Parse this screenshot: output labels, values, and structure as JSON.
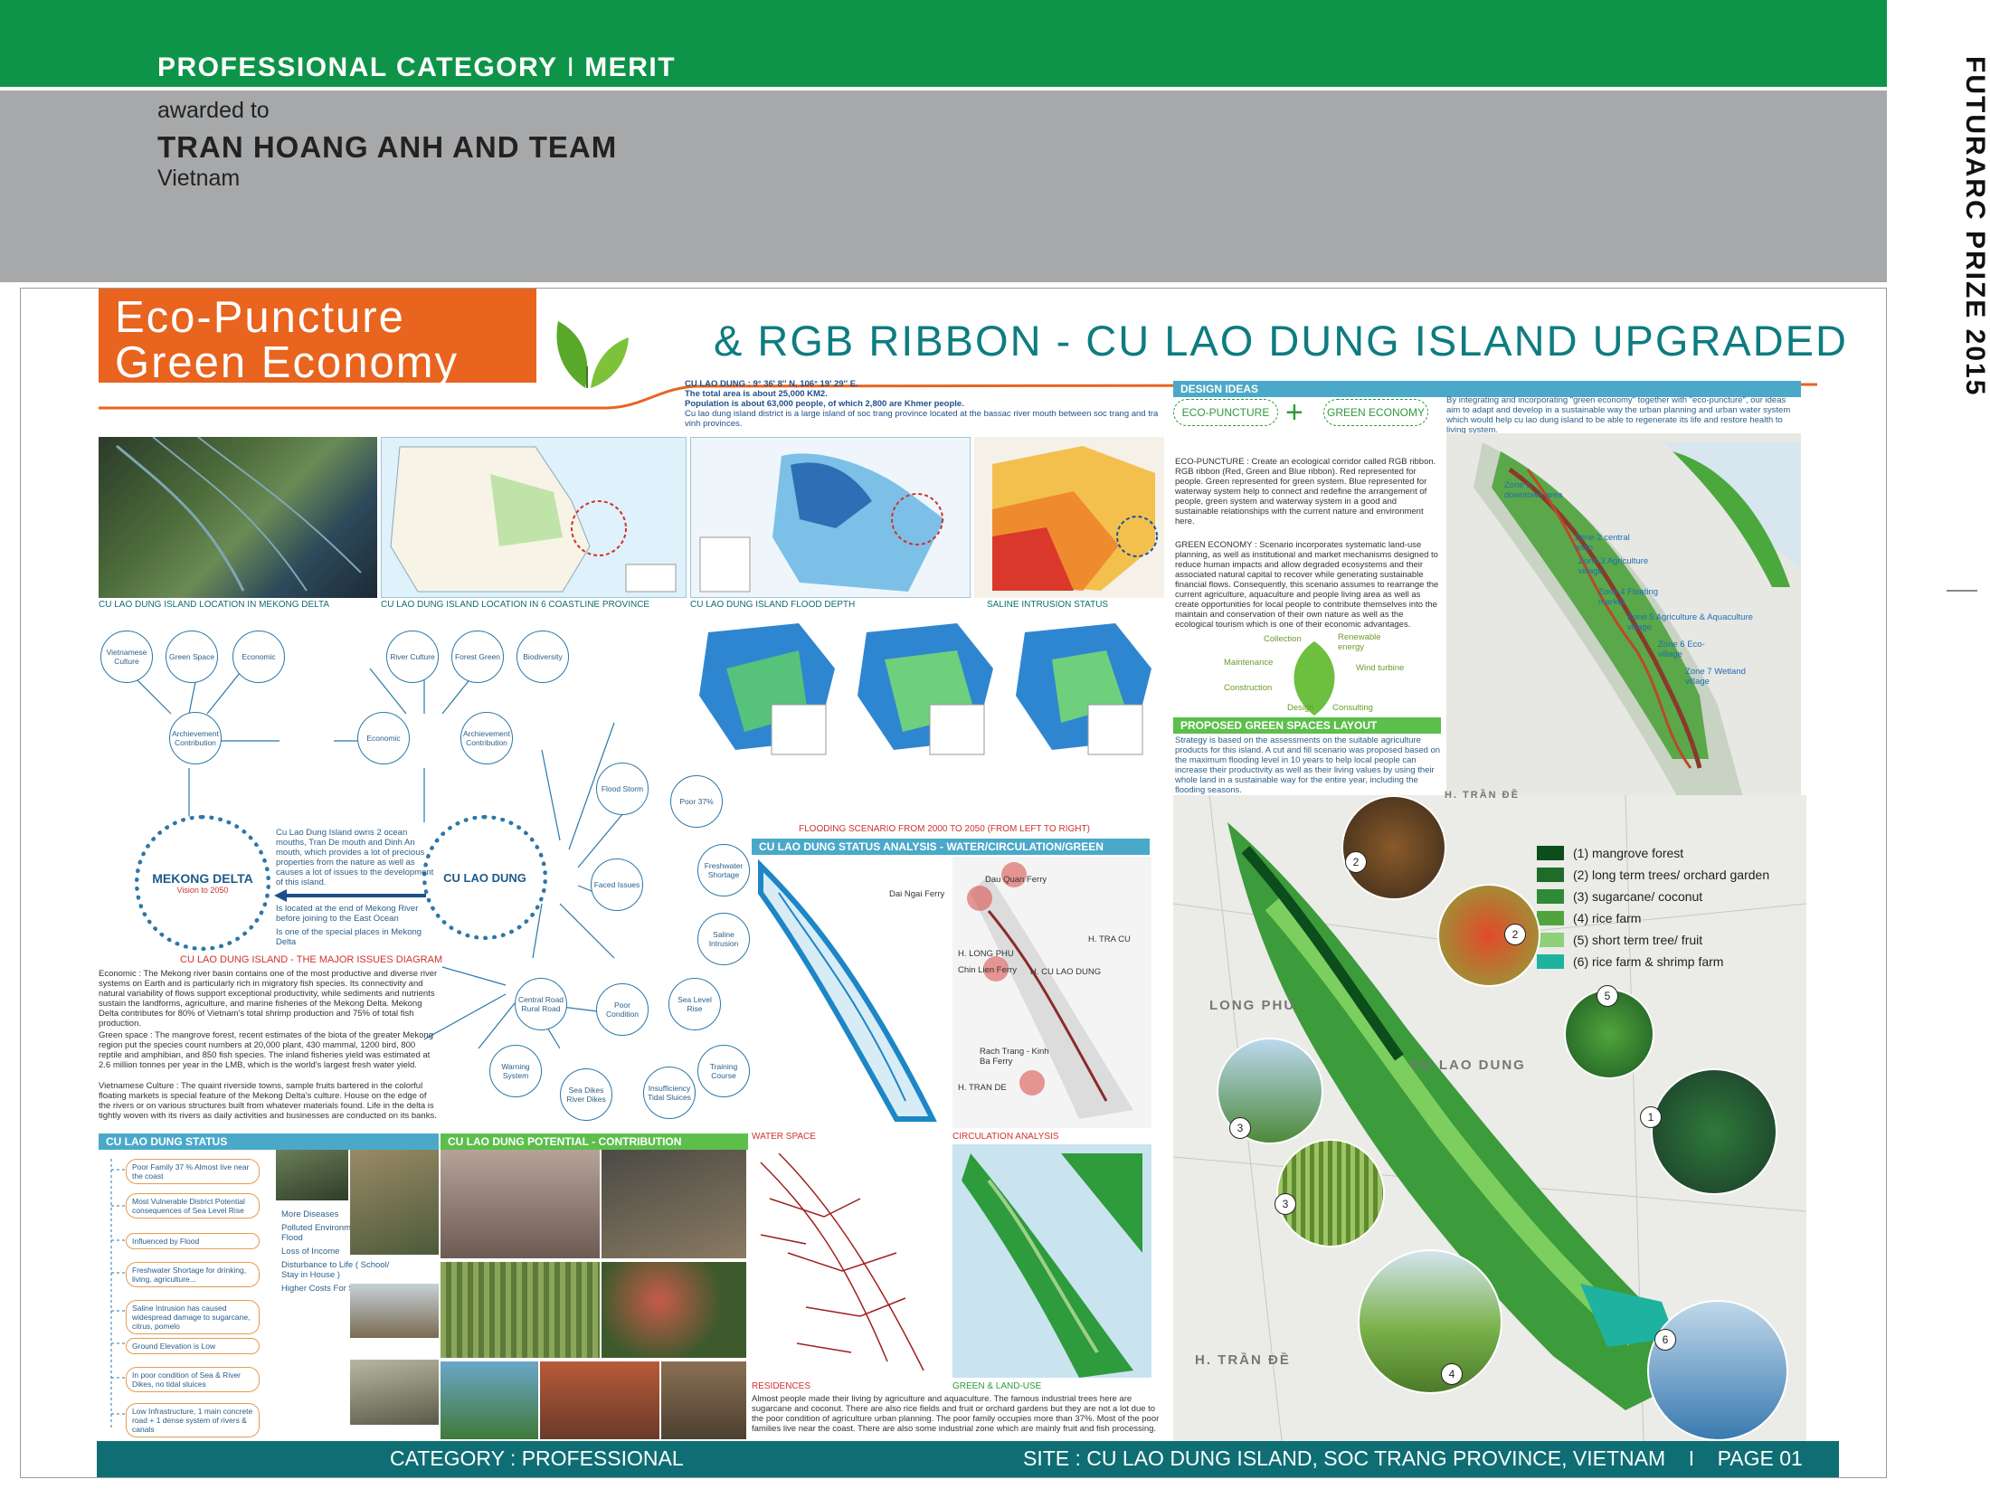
{
  "award": {
    "category": "PROFESSIONAL CATEGORY",
    "separator": "I",
    "level": "MERIT",
    "awarded_to": "awarded to",
    "team": "TRAN HOANG ANH AND TEAM",
    "country": "Vietnam",
    "prize": "FUTURARC PRIZE 2015"
  },
  "poster": {
    "logo_line1": "Eco-Puncture",
    "logo_line2": "Green Economy",
    "title": "& RGB RIBBON - CU LAO DUNG ISLAND UPGRADED",
    "intro": {
      "line1": "CU LAO DUNG : 9° 36' 8'' N, 106° 19' 29'' E.",
      "line2": "The total area is about 25,000 KM2.",
      "line3": "Population is about 63,000 people, of which 2,800 are Khmer people.",
      "line4": "Cu lao dung island district is a large island of soc trang province located at the bassac river mouth between soc trang and tra vinh provinces."
    },
    "captions": {
      "mekong_location": "CU LAO DUNG ISLAND LOCATION IN MEKONG DELTA",
      "coastline_location": "CU LAO DUNG ISLAND LOCATION IN 6 COASTLINE PROVINCE",
      "flood_depth": "CU LAO DUNG ISLAND FLOOD DEPTH",
      "saline": "SALINE INTRUSION STATUS",
      "flooding_scenario": "FLOODING SCENARIO FROM 2000 TO 2050 (FROM LEFT TO RIGHT)",
      "issues_diagram": "CU LAO DUNG ISLAND - THE MAJOR ISSUES DIAGRAM",
      "water_space": "WATER SPACE",
      "circulation": "CIRCULATION ANALYSIS",
      "residences": "RESIDENCES",
      "green_land": "GREEN & LAND-USE"
    },
    "bars": {
      "status_analysis": "CU LAO DUNG STATUS ANALYSIS - WATER/CIRCULATION/GREEN",
      "status": "CU LAO DUNG STATUS",
      "potential": "CU LAO DUNG POTENTIAL - CONTRIBUTION",
      "design_ideas": "DESIGN IDEAS",
      "green_spaces": "PROPOSED GREEN SPACES LAYOUT"
    },
    "diagram": {
      "top_nodes": [
        "Vietnamese Culture",
        "Green Space",
        "Economic",
        "River Culture",
        "Forest Green",
        "Biodiversity"
      ],
      "achievement_left": "Archievement Contribution",
      "economic_mid": "Economic",
      "achievement_right": "Archievement Contribution",
      "mekong": "MEKONG DELTA",
      "vision": "Vision to 2050",
      "culaodung": "CU LAO DUNG",
      "faced_issues": "Faced Issues",
      "poor_condition": "Poor Condition",
      "issue_nodes": [
        "Flood Storm",
        "Poor 37%",
        "Freshwater Shortage",
        "Saline Intrusion",
        "Sea Level Rise",
        "Training Course",
        "Insufficiency Tidal Sluices",
        "Sea Dikes River Dikes",
        "Warning System",
        "Central Road Rural Road"
      ],
      "note1": "Cu Lao Dung Island owns 2 ocean mouths, Tran De mouth and Dinh An mouth, which provides a lot of precious properties from the nature as well as causes a lot of issues to the development of this island.",
      "note2": "Is located at the end of Mekong River before joining to the East Ocean",
      "note3": "Is one of the special places in Mekong Delta"
    },
    "paragraphs": {
      "economic": "Economic : The Mekong river basin contains one of the most productive and diverse river systems on Earth and is particularly rich in migratory fish species. Its connectivity and natural variability of flows support exceptional productivity, while sediments and nutrients sustain the landforms, agriculture, and marine fisheries of the Mekong Delta. Mekong Delta contributes for 80% of Vietnam's total shrimp production and 75% of total fish production.",
      "green": "Green space : The mangrove forest, recent estimates of the biota of the greater Mekong region put the species count numbers at 20,000 plant, 430 mammal, 1200 bird, 800 reptile and amphibian, and 850 fish species. The inland fisheries yield was estimated at 2.6 million tonnes per year in the LMB, which is the world's largest fresh water yield.",
      "culture": "Vietnamese Culture : The quaint riverside towns, sample fruits bartered in the colorful floating markets is special feature of the Mekong Delta's culture. House on the edge of the rivers or on various structures built from whatever materials found. Life in the delta is tightly woven with its rivers as daily activities and businesses are conducted on its banks."
    },
    "status_items": [
      "Poor Family 37 % Almost live near the coast",
      "Most Vulnerable District Potential consequences of Sea Level Rise",
      "Influenced by Flood",
      "Freshwater Shortage for drinking, living, agriculture...",
      "Saline Intrusion has caused widespread damage to sugarcane, citrus, pomelo",
      "Ground Elevation is Low",
      "In poor condition of Sea & River Dikes, no tidal sluices",
      "Low Infrastructure, 1 main concrete road + 1 dense system of rivers & canals"
    ],
    "flood_effects": [
      "More Diseases",
      "Polluted Environment during Flood",
      "Loss of Income",
      "Disturbance to Life ( School/ Stay in House )",
      "Higher Costs For Sanitation"
    ],
    "map_labels": {
      "ferry1": "Dai Ngai Ferry",
      "ferry2": "Dau Quan Ferry",
      "ferry3": "Chin Lien Ferry",
      "ferry4": "Rach Trang - Kinh Ba Ferry",
      "cu_lao": "H. CU LAO DUNG",
      "tra_cu": "H. TRA CU",
      "long_phu_small": "H. LONG PHU",
      "tran_de_small": "H. TRAN DE"
    },
    "residence_text": "Almost people made their living by agriculture and aquaculture. The famous industrial trees here are sugarcane and coconut. There are also rice fields and fruit or orchard gardens but they are not a lot due to the poor condition of agriculture urban planning. The poor family occupies more than 37%. Most of the poor families live near the coast. There are also some industrial zone which are mainly fruit and fish processing.",
    "design": {
      "eco": "ECO-PUNCTURE",
      "green": "GREEN ECONOMY",
      "plus": "+",
      "intro": "By integrating and incorporating \"green economy\" together with \"eco-puncture\", our ideas aim to adapt and develop in a sustainable way the urban planning and urban water system which would help cu lao dung island to be able to regenerate its life and restore health to living system.",
      "eco_text": "ECO-PUNCTURE : Create an ecological corridor called RGB ribbon. RGB ribbon (Red, Green and Blue ribbon). Red represented for people. Green represented for green system. Blue represented for waterway system help to connect and redefine the arrangement of people, green system and waterway system in a good and sustainable relationships with the current nature and environment here.",
      "green_text": "GREEN ECONOMY : Scenario incorporates systematic land-use planning, as well as institutional and market mechanisms designed to reduce human impacts and allow degraded ecosystems and their associated natural capital to recover while generating sustainable financial flows. Consequently, this scenario assumes to rearrange the current agriculture, aquaculture and people living area as well as create opportunities for local people to contribute themselves into the maintain and conservation of their own nature as well as the ecological tourism which is one of their economic advantages.",
      "strategy": "Strategy is based on the assessments on the suitable agriculture products for this island. A cut and fill scenario was proposed based on the maximum flooding level in 10 years to help local people can increase their productivity as well as their living values by using their whole land in a sustainable way for the entire year, including the flooding seasons.",
      "leaf_labels": [
        "Collection",
        "Renewable energy",
        "Maintenance",
        "Wind turbine",
        "Construction",
        "Design",
        "Consulting"
      ]
    },
    "zones": [
      "Zone 1 downtown area",
      "Zone 2 central town",
      "Zone 3 Agriculture village",
      "Zone 4 Floating market",
      "Zone 5 Agriculture & Aquaculture village",
      "Zone 6 Eco-village",
      "Zone 7 Wetland village"
    ],
    "plan_labels": {
      "long_phu": "LONG PHÚ",
      "cu_lao_dung": "CU LAO DUNG",
      "tran_de": "H. TRẦN ĐỀ"
    },
    "legend": [
      {
        "label": "(1) mangrove forest",
        "color": "#0c4d1c"
      },
      {
        "label": "(2) long term trees/ orchard garden",
        "color": "#1f6b2a"
      },
      {
        "label": "(3) sugarcane/ coconut",
        "color": "#2f8a35"
      },
      {
        "label": "(4) rice farm",
        "color": "#4fa53c"
      },
      {
        "label": "(5) short term tree/ fruit",
        "color": "#8fd07a"
      },
      {
        "label": "(6) rice farm & shrimp farm",
        "color": "#1fb2a1"
      }
    ],
    "photo_numbers": [
      "2",
      "2",
      "5",
      "1",
      "3",
      "3",
      "4",
      "6"
    ],
    "footer": {
      "left": "CATEGORY : PROFESSIONAL",
      "right": "SITE : CU LAO DUNG ISLAND, SOC TRANG PROVINCE, VIETNAM    I    PAGE 01"
    }
  }
}
